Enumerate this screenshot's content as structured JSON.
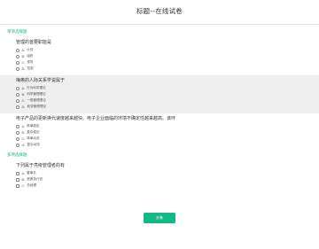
{
  "header": {
    "title": "标题--在线试卷"
  },
  "sections": [
    {
      "title": "单项选择题",
      "type": "single",
      "questions": [
        {
          "text": "管理的首要职能是",
          "options": [
            {
              "key": "A:",
              "label": "计划"
            },
            {
              "key": "B:",
              "label": "组织"
            },
            {
              "key": "C:",
              "label": "领导"
            },
            {
              "key": "D:",
              "label": "控制"
            }
          ]
        },
        {
          "text": "梅奥的人际关系学说属于",
          "options": [
            {
              "key": "A:",
              "label": "行为科学理论"
            },
            {
              "key": "B:",
              "label": "科学管理理论"
            },
            {
              "key": "C:",
              "label": "一般管理理论"
            },
            {
              "key": "D:",
              "label": "权变管理理论"
            }
          ]
        },
        {
          "text": "电子产品的更新换代速度越来越快。电子企业面临的环境不确定性越来越高。该环",
          "options": [
            {
              "key": "A:",
              "label": "简单稳定"
            },
            {
              "key": "B:",
              "label": "复杂稳定"
            },
            {
              "key": "C:",
              "label": "简单动态"
            },
            {
              "key": "D:",
              "label": "复杂动态"
            }
          ]
        }
      ]
    },
    {
      "title": "多项选择题",
      "type": "multiple",
      "questions": [
        {
          "text": "下列属于亮级管理者的有",
          "options": [
            {
              "key": "A:",
              "label": "董事长"
            },
            {
              "key": "B:",
              "label": "首席执行官"
            },
            {
              "key": "C:",
              "label": "总经理"
            }
          ]
        }
      ]
    }
  ],
  "submit": {
    "label": "交卷"
  },
  "colors": {
    "accent": "#12b886",
    "shaded_row": "#efefef"
  }
}
